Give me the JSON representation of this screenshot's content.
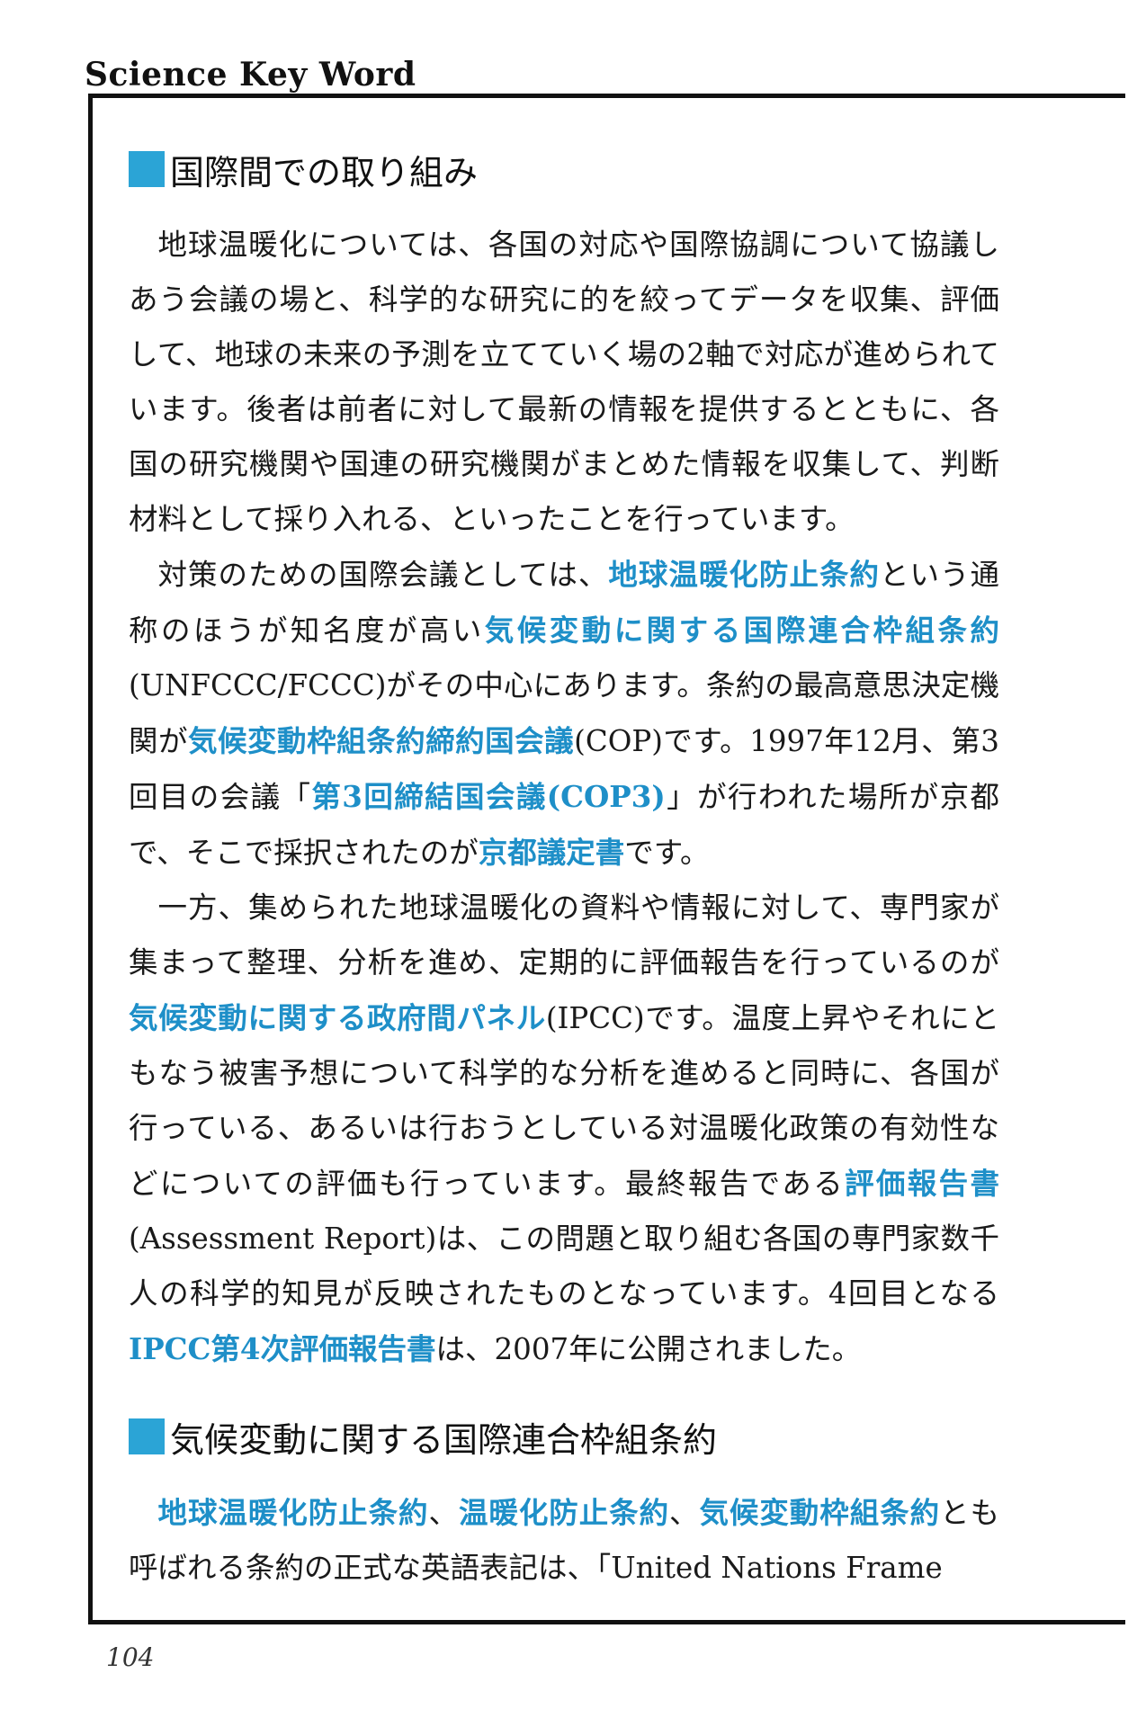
{
  "header": {
    "title": "Science Key Word"
  },
  "section1": {
    "heading": "国際間での取り組み",
    "p1": "地球温暖化については、各国の対応や国際協調について協議しあう会議の場と、科学的な研究に的を絞ってデータを収集、評価して、地球の未来の予測を立てていく場の2軸で対応が進められています。後者は前者に対して最新の情報を提供するとともに、各国の研究機関や国連の研究機関がまとめた情報を収集して、判断材料として採り入れる、といったことを行っています。",
    "p2": {
      "t1": "対策のための国際会議としては、",
      "k1": "地球温暖化防止条約",
      "t2": "という通称のほうが知名度が高い",
      "k2": "気候変動に関する国際連合枠組条約",
      "t3": "(UNFCCC/FCCC)がその中心にあります。条約の最高意思決定機関が",
      "k3": "気候変動枠組条約締約国会議",
      "t4": "(COP)です。1997年12月、第3回目の会議「",
      "k4": "第3回締結国会議(COP3)",
      "t5": "」が行われた場所が京都で、そこで採択されたのが",
      "k5": "京都議定書",
      "t6": "です。"
    },
    "p3": {
      "t1": "一方、集められた地球温暖化の資料や情報に対して、専門家が集まって整理、分析を進め、定期的に評価報告を行っているのが",
      "k1": "気候変動に関する政府間パネル",
      "t2": "(IPCC)です。温度上昇やそれにともなう被害予想について科学的な分析を進めると同時に、各国が行っている、あるいは行おうとしている対温暖化政策の有効性などについての評価も行っています。最終報告である",
      "k2": "評価報告書",
      "t3": "(Assessment Report)は、この問題と取り組む各国の専門家数千人の科学的知見が反映されたものとなっています。4回目となる",
      "k3": "IPCC第4次評価報告書",
      "t4": "は、2007年に公開されました。"
    }
  },
  "section2": {
    "heading": "気候変動に関する国際連合枠組条約",
    "p1": {
      "k1": "地球温暖化防止条約",
      "t1": "、",
      "k2": "温暖化防止条約",
      "t2": "、",
      "k3": "気候変動枠組条約",
      "t3": "とも呼ばれる条約の正式な英語表記は、「United Nations Frame"
    }
  },
  "footer": {
    "page_number": "104"
  },
  "colors": {
    "accent": "#2ba4d6",
    "keyword": "#1e8fc8"
  }
}
